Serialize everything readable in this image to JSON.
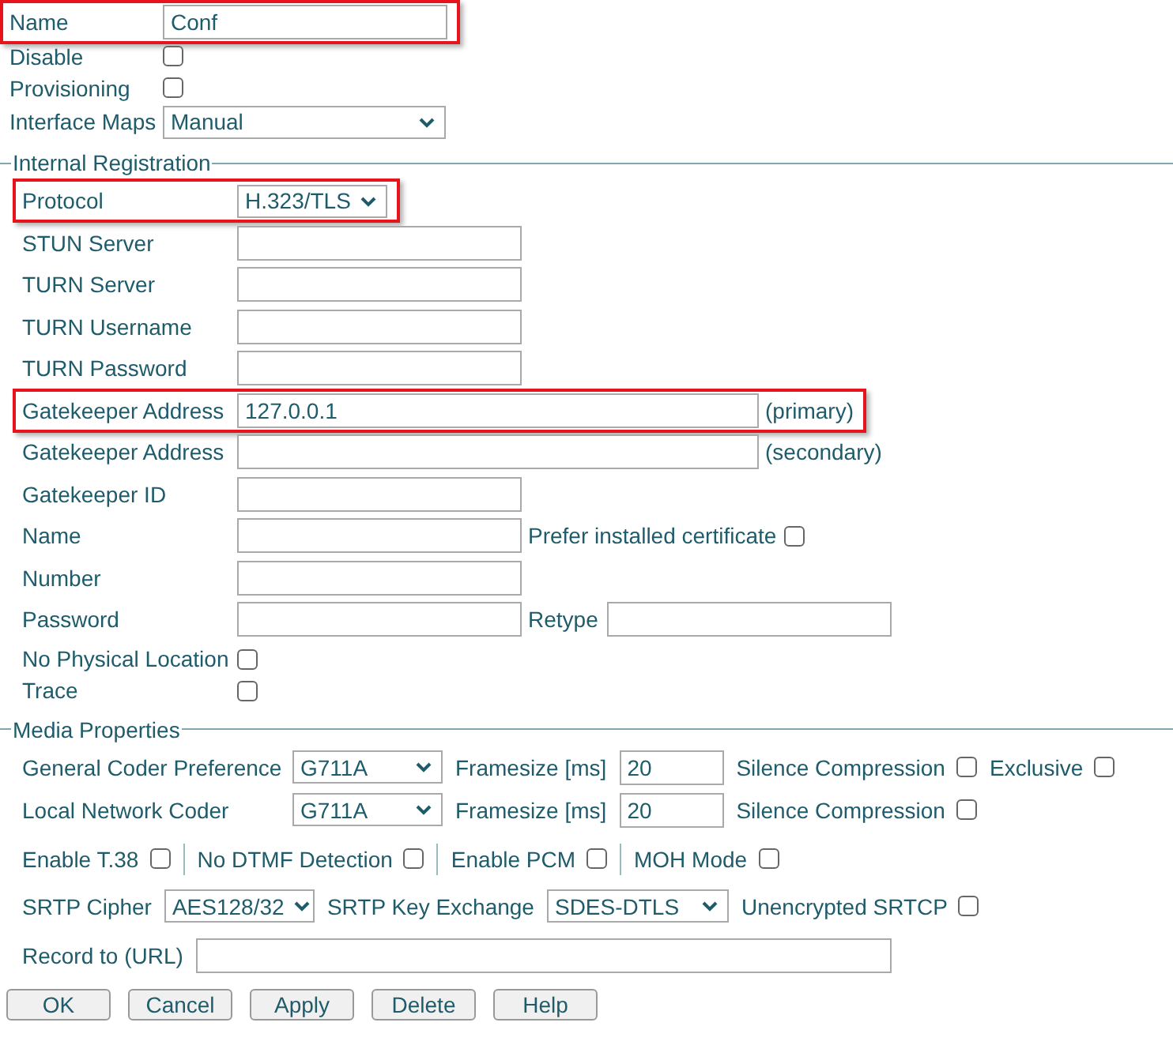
{
  "general": [
    {
      "label": "Name",
      "highlighted": true,
      "controls": [
        {
          "kind": "field",
          "value": "Conf"
        }
      ]
    },
    {
      "label": "Disable",
      "highlighted": false,
      "controls": [
        {
          "kind": "checkbox",
          "checked": false
        }
      ]
    },
    {
      "label": "Provisioning",
      "highlighted": false,
      "controls": [
        {
          "kind": "checkbox",
          "checked": false
        }
      ]
    },
    {
      "label": "Interface Maps",
      "highlighted": false,
      "controls": [
        {
          "kind": "wide-select",
          "value": "Manual"
        }
      ]
    }
  ],
  "internal_registration": {
    "title": "Internal Registration",
    "rows": [
      {
        "label": "Protocol",
        "highlighted": true,
        "controls": [
          {
            "kind": "select",
            "value": "H.323/TLS"
          }
        ]
      },
      {
        "label": "STUN Server",
        "highlighted": false,
        "controls": [
          {
            "kind": "field"
          }
        ]
      },
      {
        "label": "TURN Server",
        "highlighted": false,
        "controls": [
          {
            "kind": "field"
          }
        ]
      },
      {
        "label": "TURN Username",
        "highlighted": false,
        "controls": [
          {
            "kind": "field"
          }
        ]
      },
      {
        "label": "TURN Password",
        "highlighted": false,
        "controls": [
          {
            "kind": "field"
          }
        ]
      },
      {
        "label": "Gatekeeper Address",
        "highlighted": true,
        "controls": [
          {
            "kind": "long-field",
            "value": "127.0.0.1"
          },
          {
            "kind": "text",
            "text": "(primary)"
          }
        ]
      },
      {
        "label": "Gatekeeper Address",
        "highlighted": false,
        "controls": [
          {
            "kind": "long-field"
          },
          {
            "kind": "text",
            "text": "(secondary)"
          }
        ]
      },
      {
        "label": "Gatekeeper ID",
        "highlighted": false,
        "controls": [
          {
            "kind": "field"
          }
        ]
      },
      {
        "label": "Name",
        "highlighted": false,
        "controls": [
          {
            "kind": "field"
          },
          {
            "kind": "text",
            "text": "Prefer installed certificate"
          },
          {
            "kind": "checkbox",
            "checked": false
          }
        ]
      },
      {
        "label": "Number",
        "highlighted": false,
        "controls": [
          {
            "kind": "field"
          }
        ]
      },
      {
        "label": "Password",
        "highlighted": false,
        "controls": [
          {
            "kind": "field"
          },
          {
            "kind": "text",
            "text": "Retype"
          },
          {
            "kind": "field"
          }
        ]
      },
      {
        "label": "No Physical Location",
        "highlighted": false,
        "controls": [
          {
            "kind": "checkbox",
            "checked": false
          }
        ]
      },
      {
        "label": "Trace",
        "highlighted": false,
        "controls": [
          {
            "kind": "checkbox",
            "checked": false
          }
        ]
      }
    ]
  },
  "media_properties": {
    "title": "Media Properties",
    "rows": [
      {
        "label": "General Coder Preference",
        "controls": [
          {
            "kind": "select",
            "value": "G711A"
          },
          {
            "kind": "text",
            "text": "Framesize [ms]"
          },
          {
            "kind": "short-field",
            "value": "20"
          },
          {
            "kind": "text",
            "text": "Silence Compression"
          },
          {
            "kind": "checkbox",
            "checked": false
          },
          {
            "kind": "text",
            "text": "Exclusive"
          },
          {
            "kind": "checkbox",
            "checked": false
          }
        ]
      },
      {
        "label": "Local Network Coder",
        "controls": [
          {
            "kind": "select",
            "value": "G711A"
          },
          {
            "kind": "text",
            "text": "Framesize [ms]"
          },
          {
            "kind": "short-field",
            "value": "20"
          },
          {
            "kind": "text",
            "text": "Silence Compression"
          },
          {
            "kind": "checkbox",
            "checked": false
          }
        ]
      },
      {
        "controls": [
          {
            "kind": "text",
            "text": "Enable T.38"
          },
          {
            "kind": "checkbox",
            "checked": false
          },
          {
            "kind": "separator"
          },
          {
            "kind": "text",
            "text": "No DTMF Detection"
          },
          {
            "kind": "checkbox",
            "checked": false
          },
          {
            "kind": "separator"
          },
          {
            "kind": "text",
            "text": "Enable PCM"
          },
          {
            "kind": "checkbox",
            "checked": false
          },
          {
            "kind": "separator"
          },
          {
            "kind": "text",
            "text": "MOH Mode"
          },
          {
            "kind": "checkbox",
            "checked": false
          }
        ]
      },
      {
        "controls": [
          {
            "kind": "text",
            "text": "SRTP Cipher"
          },
          {
            "kind": "select",
            "value": "AES128/32"
          },
          {
            "kind": "text",
            "text": "SRTP Key Exchange"
          },
          {
            "kind": "wide-select",
            "value": "SDES-DTLS"
          },
          {
            "kind": "text",
            "text": "Unencrypted SRTCP"
          },
          {
            "kind": "checkbox",
            "checked": false
          }
        ]
      },
      {
        "controls": [
          {
            "kind": "text",
            "text": "Record to (URL)"
          },
          {
            "kind": "url-field"
          }
        ]
      }
    ]
  },
  "buttons": [
    "OK",
    "Cancel",
    "Apply",
    "Delete",
    "Help"
  ]
}
